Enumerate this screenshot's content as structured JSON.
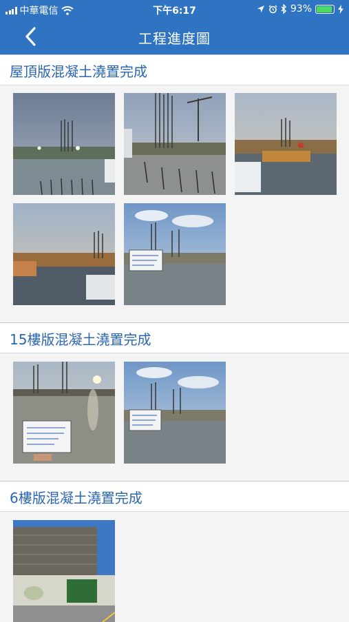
{
  "status_bar": {
    "carrier": "中華電信",
    "time": "下午6:17",
    "battery": "93%",
    "battery_level": 0.93
  },
  "nav": {
    "title": "工程進度圖"
  },
  "sections": [
    {
      "title": "屋頂版混凝土澆置完成",
      "photo_count": 5
    },
    {
      "title": "15樓版混凝土澆置完成",
      "photo_count": 2
    },
    {
      "title": "6樓版混凝土澆置完成",
      "photo_count": 1
    }
  ],
  "icons": {
    "back": "chevron-left-icon",
    "wifi": "wifi-icon",
    "location": "location-arrow-icon",
    "alarm": "alarm-clock-icon",
    "bluetooth": "bluetooth-icon",
    "battery": "battery-icon",
    "charging": "charging-bolt-icon"
  }
}
